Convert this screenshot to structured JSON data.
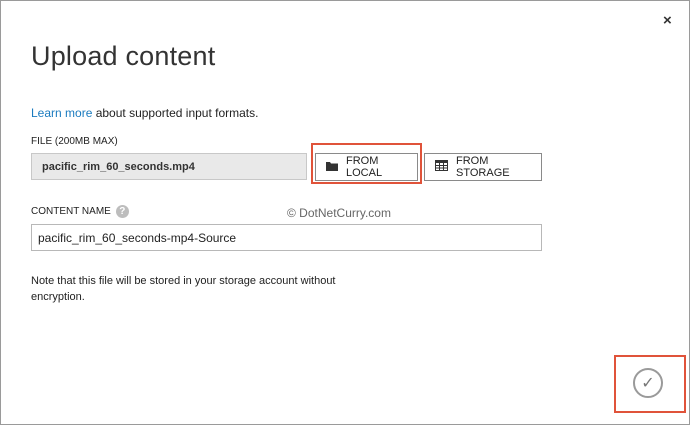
{
  "dialog": {
    "close_icon": "×",
    "title": "Upload content",
    "learn_more_link": "Learn more",
    "learn_more_rest": " about supported input formats."
  },
  "file": {
    "label": "FILE (200MB MAX)",
    "value": "pacific_rim_60_seconds.mp4",
    "from_local_label": "FROM LOCAL",
    "from_storage_label": "FROM STORAGE"
  },
  "content_name": {
    "label": "CONTENT NAME",
    "help_icon": "?",
    "value": "pacific_rim_60_seconds-mp4-Source"
  },
  "watermark": "© DotNetCurry.com",
  "note": "Note that this file will be stored in your storage account without encryption.",
  "confirm_icon": "✓"
}
